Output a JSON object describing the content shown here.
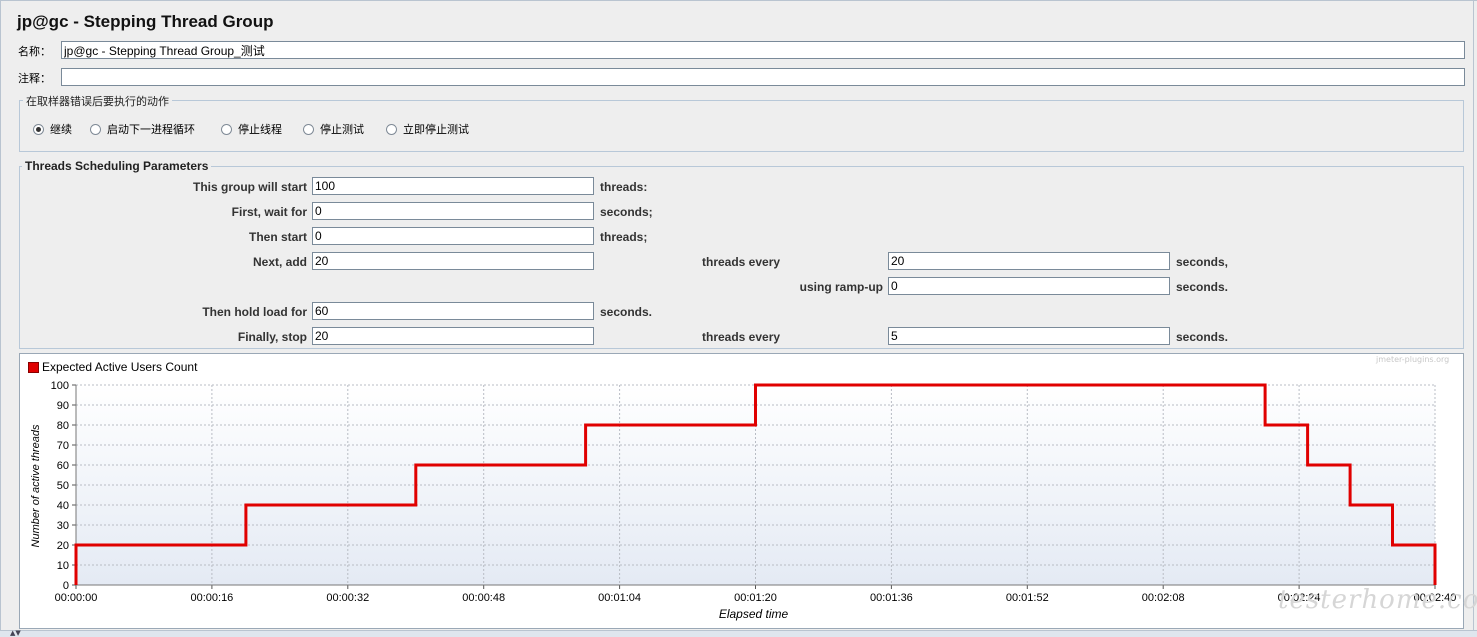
{
  "panel": {
    "title": "jp@gc - Stepping Thread Group",
    "name_label": "名称：",
    "name_value": "jp@gc - Stepping Thread Group_测试",
    "comment_label": "注释：",
    "comment_value": ""
  },
  "error_action": {
    "title": "在取样器错误后要执行的动作",
    "options": [
      {
        "label": "继续",
        "selected": true
      },
      {
        "label": "启动下一进程循环",
        "selected": false
      },
      {
        "label": "停止线程",
        "selected": false
      },
      {
        "label": "停止测试",
        "selected": false
      },
      {
        "label": "立即停止测试",
        "selected": false
      }
    ]
  },
  "params": {
    "title": "Threads Scheduling Parameters",
    "this_group_label": "This group will start",
    "this_group_value": "100",
    "this_group_unit": "threads:",
    "first_wait_label": "First, wait for",
    "first_wait_value": "0",
    "first_wait_unit": "seconds;",
    "then_start_label": "Then start",
    "then_start_value": "0",
    "then_start_unit": "threads;",
    "next_add_label": "Next, add",
    "next_add_value": "20",
    "next_add_mid": "threads every",
    "next_add_every_value": "20",
    "next_add_unit": "seconds,",
    "rampup_label": "using ramp-up",
    "rampup_value": "0",
    "rampup_unit": "seconds.",
    "hold_label": "Then hold load for",
    "hold_value": "60",
    "hold_unit": "seconds.",
    "stop_label": "Finally, stop",
    "stop_value": "20",
    "stop_mid": "threads every",
    "stop_every_value": "5",
    "stop_unit": "seconds."
  },
  "chart_data": {
    "type": "line",
    "title": "",
    "xlabel": "Elapsed time",
    "ylabel": "Number of active threads",
    "legend_position": "top-left",
    "grid": true,
    "ylim": [
      0,
      100
    ],
    "xlim_seconds": [
      0,
      160
    ],
    "y_ticks": [
      "0",
      "10",
      "20",
      "30",
      "40",
      "50",
      "60",
      "70",
      "80",
      "90",
      "100"
    ],
    "x_ticks": [
      "00:00:00",
      "00:00:16",
      "00:00:32",
      "00:00:48",
      "00:01:04",
      "00:01:20",
      "00:01:36",
      "00:01:52",
      "00:02:08",
      "00:02:24",
      "00:02:40"
    ],
    "series": [
      {
        "name": "Expected Active Users Count",
        "color": "#e00000",
        "x_seconds": [
          0,
          0,
          20,
          20,
          40,
          40,
          60,
          60,
          80,
          80,
          140,
          140,
          145,
          145,
          150,
          150,
          155,
          155,
          160,
          160
        ],
        "values": [
          0,
          20,
          20,
          40,
          40,
          60,
          60,
          80,
          80,
          100,
          100,
          80,
          80,
          60,
          60,
          40,
          40,
          20,
          20,
          0
        ]
      }
    ]
  },
  "watermark": {
    "plugin": "jmeter-plugins.org",
    "site": "testerhome.com"
  }
}
